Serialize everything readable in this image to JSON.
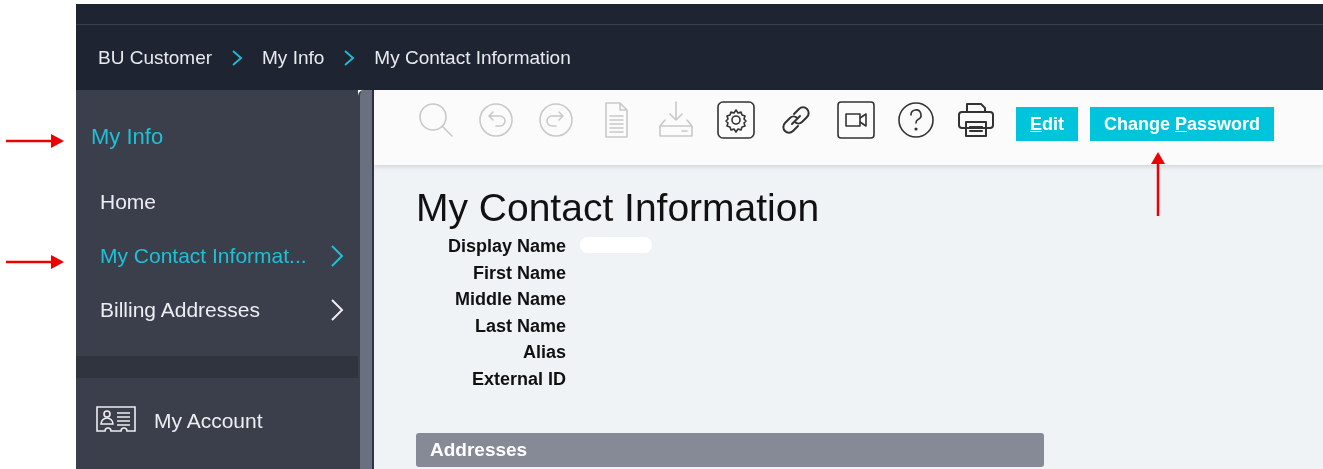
{
  "breadcrumb": [
    "BU Customer",
    "My Info",
    "My Contact Information"
  ],
  "sidebar": {
    "section_title": "My Info",
    "items": [
      {
        "label": "Home",
        "selected": false,
        "has_submenu": false
      },
      {
        "label": "My Contact Informat...",
        "selected": true,
        "has_submenu": true
      },
      {
        "label": "Billing Addresses",
        "selected": false,
        "has_submenu": true
      }
    ],
    "footer_item": {
      "label": "My Account"
    }
  },
  "toolbar": {
    "icons": [
      {
        "kind": "search",
        "disabled": true
      },
      {
        "kind": "undo",
        "disabled": true
      },
      {
        "kind": "redo",
        "disabled": true
      },
      {
        "kind": "document",
        "disabled": true
      },
      {
        "kind": "download",
        "disabled": true
      },
      {
        "kind": "settings",
        "disabled": false
      },
      {
        "kind": "link",
        "disabled": false
      },
      {
        "kind": "video",
        "disabled": false
      },
      {
        "kind": "help",
        "disabled": false
      },
      {
        "kind": "print",
        "disabled": false
      }
    ],
    "buttons": [
      {
        "key": "E",
        "after": "dit"
      },
      {
        "before": "Change ",
        "key": "P",
        "after": "assword"
      }
    ]
  },
  "page": {
    "title": "My Contact Information",
    "fields": [
      {
        "label": "Display Name"
      },
      {
        "label": "First Name"
      },
      {
        "label": "Middle Name"
      },
      {
        "label": "Last Name"
      },
      {
        "label": "Alias"
      },
      {
        "label": "External ID"
      }
    ],
    "section": "Addresses"
  },
  "annotation_arrows": [
    {
      "kind": "right"
    },
    {
      "kind": "right"
    },
    {
      "kind": "up"
    }
  ]
}
